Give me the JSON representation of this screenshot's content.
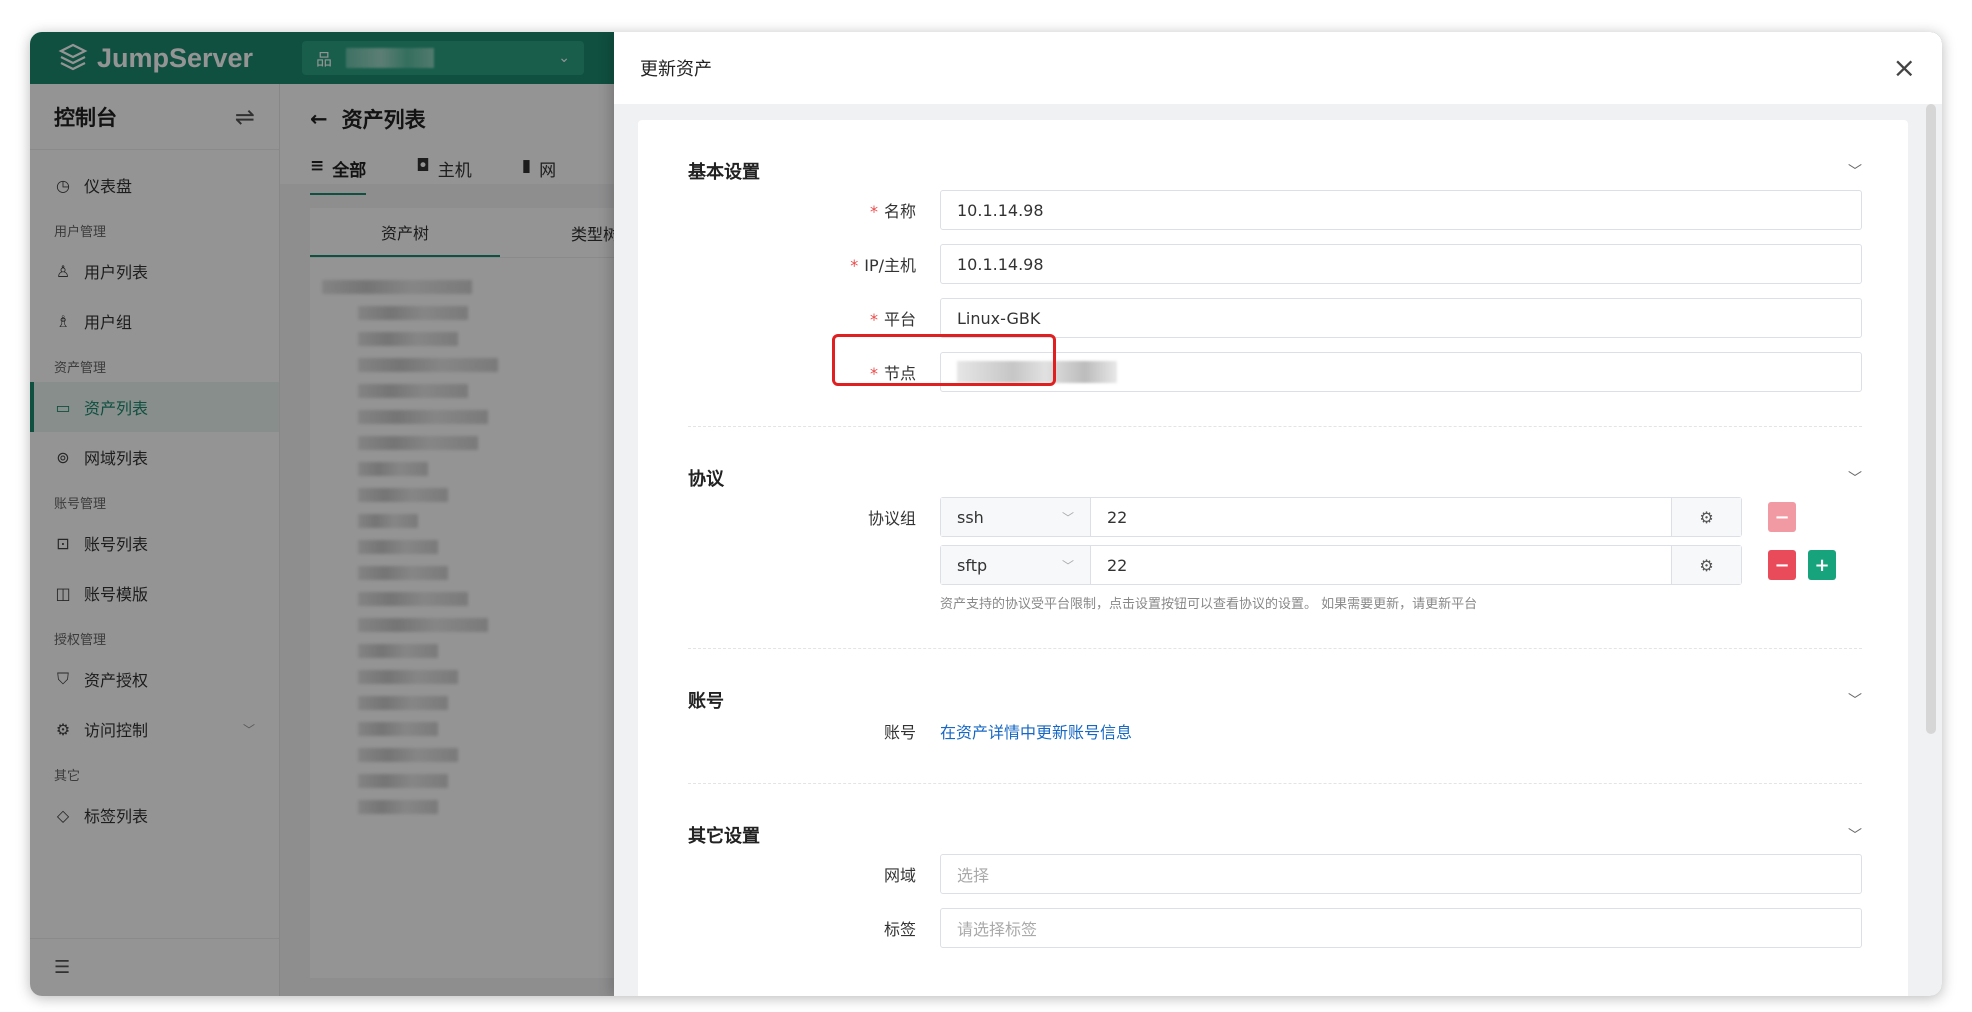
{
  "brand": "JumpServer",
  "org_select": {
    "chevron": "⌄"
  },
  "sidebar": {
    "title": "控制台",
    "groups": [
      {
        "label": "",
        "items": [
          {
            "icon": "dashboard-icon",
            "label": "仪表盘"
          }
        ]
      },
      {
        "label": "用户管理",
        "items": [
          {
            "icon": "user-icon",
            "label": "用户列表"
          },
          {
            "icon": "user-group-icon",
            "label": "用户组"
          }
        ]
      },
      {
        "label": "资产管理",
        "items": [
          {
            "icon": "monitor-icon",
            "label": "资产列表",
            "active": true
          },
          {
            "icon": "location-icon",
            "label": "网域列表"
          }
        ]
      },
      {
        "label": "账号管理",
        "items": [
          {
            "icon": "lock-icon",
            "label": "账号列表"
          },
          {
            "icon": "template-icon",
            "label": "账号模版"
          }
        ]
      },
      {
        "label": "授权管理",
        "items": [
          {
            "icon": "shield-icon",
            "label": "资产授权"
          },
          {
            "icon": "access-control-icon",
            "label": "访问控制"
          }
        ]
      },
      {
        "label": "其它",
        "items": [
          {
            "icon": "tag-icon",
            "label": "标签列表"
          }
        ]
      }
    ]
  },
  "main": {
    "back_arrow": "←",
    "title": "资产列表",
    "tabs": [
      {
        "icon": "≡",
        "label": "全部"
      },
      {
        "icon": "◘",
        "label": "主机"
      },
      {
        "icon": "▮",
        "label": "网"
      }
    ],
    "tree_tabs": [
      "资产树",
      "类型树"
    ]
  },
  "drawer": {
    "title": "更新资产",
    "close": "×",
    "sections": {
      "basic": {
        "title": "基本设置",
        "fields": {
          "name": {
            "label": "名称",
            "value": "10.1.14.98"
          },
          "ip": {
            "label": "IP/主机",
            "value": "10.1.14.98"
          },
          "platform": {
            "label": "平台",
            "value": "Linux-GBK"
          },
          "node": {
            "label": "节点"
          }
        }
      },
      "protocol": {
        "title": "协议",
        "label": "协议组",
        "rows": [
          {
            "protocol": "ssh",
            "port": "22"
          },
          {
            "protocol": "sftp",
            "port": "22"
          }
        ],
        "hint": "资产支持的协议受平台限制，点击设置按钮可以查看协议的设置。 如果需要更新，请更新平台"
      },
      "account": {
        "title": "账号",
        "label": "账号",
        "link": "在资产详情中更新账号信息"
      },
      "other": {
        "title": "其它设置",
        "domain": {
          "label": "网域",
          "placeholder": "选择"
        },
        "tags": {
          "label": "标签",
          "placeholder": "请选择标签"
        }
      }
    }
  },
  "colors": {
    "brand": "#1d8a6e",
    "danger": "#e94b5a",
    "success": "#17a47d",
    "highlight": "#e02020",
    "link": "#1768c5"
  }
}
